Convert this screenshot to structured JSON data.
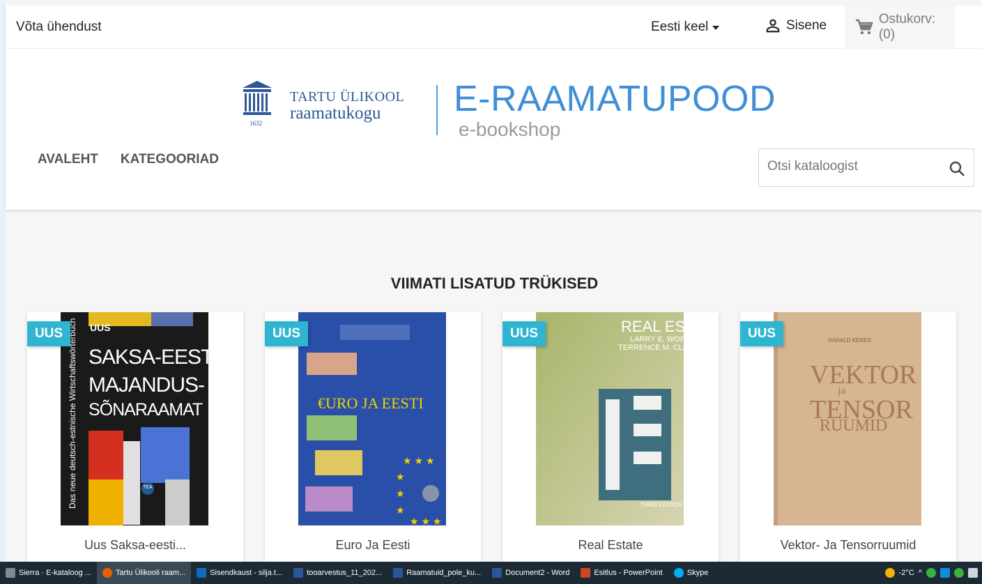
{
  "header": {
    "contact": "Võta ühendust",
    "language": "Eesti keel",
    "login": "Sisene",
    "cart": "Ostukorv: (0)"
  },
  "logo": {
    "institution_line1": "TARTU ÜLIKOOL",
    "institution_line2": "raamatukogu",
    "year": "1632",
    "shop_name": "E-RAAMATUPOOD",
    "shop_sub": "e-bookshop"
  },
  "menu": {
    "home": "AVALEHT",
    "categories": "KATEGOORIAD"
  },
  "search": {
    "placeholder": "Otsi kataloogist"
  },
  "section": {
    "title": "VIIMATI LISATUD TRÜKISED"
  },
  "products": [
    {
      "badge": "UUS",
      "title": "Uus Saksa-eesti...",
      "cover_lines": [
        "UUS",
        "SAKSA-EESTI",
        "MAJANDUS-",
        "SÕNARAAMAT"
      ],
      "cover_side": "Das neue deutsch-estnische Wirtschaftswörterbuch",
      "cover_logo": "TEA"
    },
    {
      "badge": "UUS",
      "title": "Euro Ja Eesti",
      "cover_lines": [
        "€URO JA EESTI"
      ]
    },
    {
      "badge": "UUS",
      "title": "Real Estate",
      "cover_lines": [
        "REAL ESTATE",
        "LARRY E. WOFFORD",
        "TERRENCE M. CLAURETIE",
        "THIRD EDITION"
      ]
    },
    {
      "badge": "UUS",
      "title": "Vektor- Ja Tensorruumid",
      "cover_lines": [
        "HARALD KERES",
        "VEKTOR",
        "ja",
        "TENSOR",
        "RUUMID"
      ]
    }
  ],
  "taskbar": {
    "items": [
      "Sierra · E-kataloog ...",
      "Tartu Ülikooli raam...",
      "Sisendkaust - silja.t...",
      "tooarvestus_11_202...",
      "Raamatuid_pole_ku...",
      "Document2 - Word",
      "Esitlus - PowerPoint",
      "Skype"
    ],
    "weather": "-2°C"
  },
  "colors": {
    "accent": "#2fb5d2",
    "brand_blue": "#3f8fd8",
    "university_blue": "#2c5697"
  }
}
